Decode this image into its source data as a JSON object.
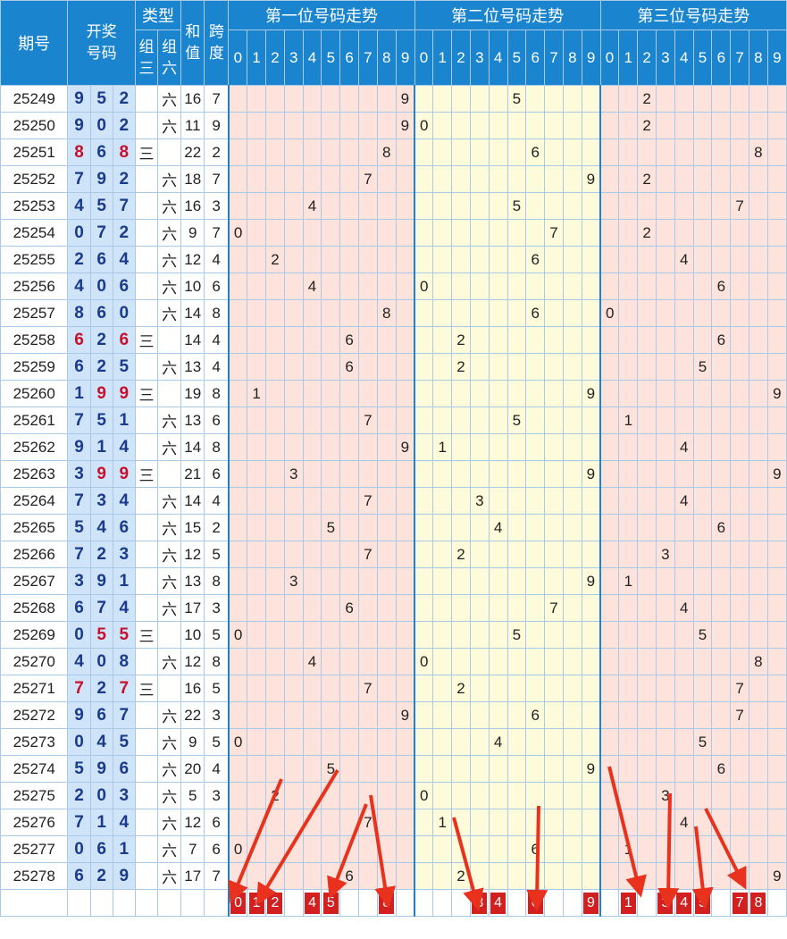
{
  "header": {
    "issue": "期号",
    "draw": "开奖号码",
    "type": "类型",
    "type_z3": "组三",
    "type_z6": "组六",
    "sum": "和值",
    "span": "跨度",
    "pos1": "第一位号码走势",
    "pos2": "第二位号码走势",
    "pos3": "第三位号码走势",
    "digits": [
      "0",
      "1",
      "2",
      "3",
      "4",
      "5",
      "6",
      "7",
      "8",
      "9"
    ]
  },
  "rows": [
    {
      "issue": "25249",
      "d": [
        "9",
        "5",
        "2"
      ],
      "t": "六",
      "sum": "16",
      "span": "7"
    },
    {
      "issue": "25250",
      "d": [
        "9",
        "0",
        "2"
      ],
      "t": "六",
      "sum": "11",
      "span": "9"
    },
    {
      "issue": "25251",
      "d": [
        "8",
        "6",
        "8"
      ],
      "t": "三",
      "sum": "22",
      "span": "2"
    },
    {
      "issue": "25252",
      "d": [
        "7",
        "9",
        "2"
      ],
      "t": "六",
      "sum": "18",
      "span": "7"
    },
    {
      "issue": "25253",
      "d": [
        "4",
        "5",
        "7"
      ],
      "t": "六",
      "sum": "16",
      "span": "3"
    },
    {
      "issue": "25254",
      "d": [
        "0",
        "7",
        "2"
      ],
      "t": "六",
      "sum": "9",
      "span": "7"
    },
    {
      "issue": "25255",
      "d": [
        "2",
        "6",
        "4"
      ],
      "t": "六",
      "sum": "12",
      "span": "4"
    },
    {
      "issue": "25256",
      "d": [
        "4",
        "0",
        "6"
      ],
      "t": "六",
      "sum": "10",
      "span": "6"
    },
    {
      "issue": "25257",
      "d": [
        "8",
        "6",
        "0"
      ],
      "t": "六",
      "sum": "14",
      "span": "8"
    },
    {
      "issue": "25258",
      "d": [
        "6",
        "2",
        "6"
      ],
      "t": "三",
      "sum": "14",
      "span": "4"
    },
    {
      "issue": "25259",
      "d": [
        "6",
        "2",
        "5"
      ],
      "t": "六",
      "sum": "13",
      "span": "4"
    },
    {
      "issue": "25260",
      "d": [
        "1",
        "9",
        "9"
      ],
      "t": "三",
      "sum": "19",
      "span": "8"
    },
    {
      "issue": "25261",
      "d": [
        "7",
        "5",
        "1"
      ],
      "t": "六",
      "sum": "13",
      "span": "6"
    },
    {
      "issue": "25262",
      "d": [
        "9",
        "1",
        "4"
      ],
      "t": "六",
      "sum": "14",
      "span": "8"
    },
    {
      "issue": "25263",
      "d": [
        "3",
        "9",
        "9"
      ],
      "t": "三",
      "sum": "21",
      "span": "6"
    },
    {
      "issue": "25264",
      "d": [
        "7",
        "3",
        "4"
      ],
      "t": "六",
      "sum": "14",
      "span": "4"
    },
    {
      "issue": "25265",
      "d": [
        "5",
        "4",
        "6"
      ],
      "t": "六",
      "sum": "15",
      "span": "2"
    },
    {
      "issue": "25266",
      "d": [
        "7",
        "2",
        "3"
      ],
      "t": "六",
      "sum": "12",
      "span": "5"
    },
    {
      "issue": "25267",
      "d": [
        "3",
        "9",
        "1"
      ],
      "t": "六",
      "sum": "13",
      "span": "8"
    },
    {
      "issue": "25268",
      "d": [
        "6",
        "7",
        "4"
      ],
      "t": "六",
      "sum": "17",
      "span": "3"
    },
    {
      "issue": "25269",
      "d": [
        "0",
        "5",
        "5"
      ],
      "t": "三",
      "sum": "10",
      "span": "5"
    },
    {
      "issue": "25270",
      "d": [
        "4",
        "0",
        "8"
      ],
      "t": "六",
      "sum": "12",
      "span": "8"
    },
    {
      "issue": "25271",
      "d": [
        "7",
        "2",
        "7"
      ],
      "t": "三",
      "sum": "16",
      "span": "5"
    },
    {
      "issue": "25272",
      "d": [
        "9",
        "6",
        "7"
      ],
      "t": "六",
      "sum": "22",
      "span": "3"
    },
    {
      "issue": "25273",
      "d": [
        "0",
        "4",
        "5"
      ],
      "t": "六",
      "sum": "9",
      "span": "5"
    },
    {
      "issue": "25274",
      "d": [
        "5",
        "9",
        "6"
      ],
      "t": "六",
      "sum": "20",
      "span": "4"
    },
    {
      "issue": "25275",
      "d": [
        "2",
        "0",
        "3"
      ],
      "t": "六",
      "sum": "5",
      "span": "3"
    },
    {
      "issue": "25276",
      "d": [
        "7",
        "1",
        "4"
      ],
      "t": "六",
      "sum": "12",
      "span": "6"
    },
    {
      "issue": "25277",
      "d": [
        "0",
        "6",
        "1"
      ],
      "t": "六",
      "sum": "7",
      "span": "6"
    },
    {
      "issue": "25278",
      "d": [
        "6",
        "2",
        "9"
      ],
      "t": "六",
      "sum": "17",
      "span": "7"
    }
  ],
  "prediction": {
    "pos1": [
      "0",
      "1",
      "2",
      "4",
      "5",
      "8"
    ],
    "pos2": [
      "3",
      "4",
      "6",
      "9"
    ],
    "pos3": [
      "1",
      "3",
      "4",
      "5",
      "7",
      "8"
    ]
  },
  "colors": {
    "header": "#1b84cf",
    "draw_bg": "#cfe4f8",
    "draw_text": "#1a3a8c",
    "pair_text": "#c8102e",
    "zone_pink": "#fde3dc",
    "zone_yellow": "#fdfbd9",
    "pick_bg": "#d21f1f",
    "arrow": "#e8321e"
  }
}
